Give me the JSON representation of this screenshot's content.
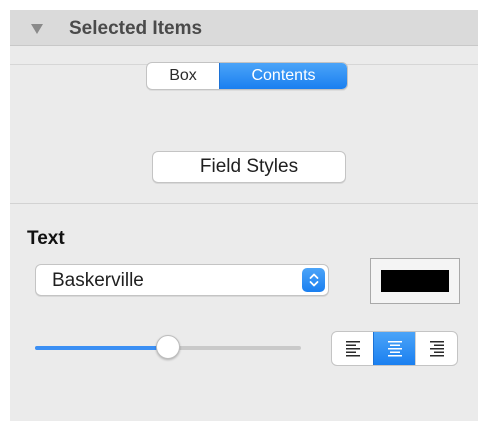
{
  "section": {
    "title": "Selected Items",
    "icon": "disclosure-triangle-icon"
  },
  "tabs": [
    {
      "label": "Box",
      "selected": false
    },
    {
      "label": "Contents",
      "selected": true
    }
  ],
  "field_styles_button": "Field Styles",
  "text_section": {
    "label": "Text",
    "font": {
      "selected": "Baskerville",
      "icon": "updown-chevron-icon"
    },
    "color": "#000000",
    "size_slider": {
      "value": 0.5
    },
    "alignment": {
      "options": [
        "left",
        "center",
        "right"
      ],
      "selected": "center"
    }
  },
  "colors": {
    "accent": "#1a7ff0",
    "panel": "#ebebeb",
    "header": "#dadada"
  }
}
